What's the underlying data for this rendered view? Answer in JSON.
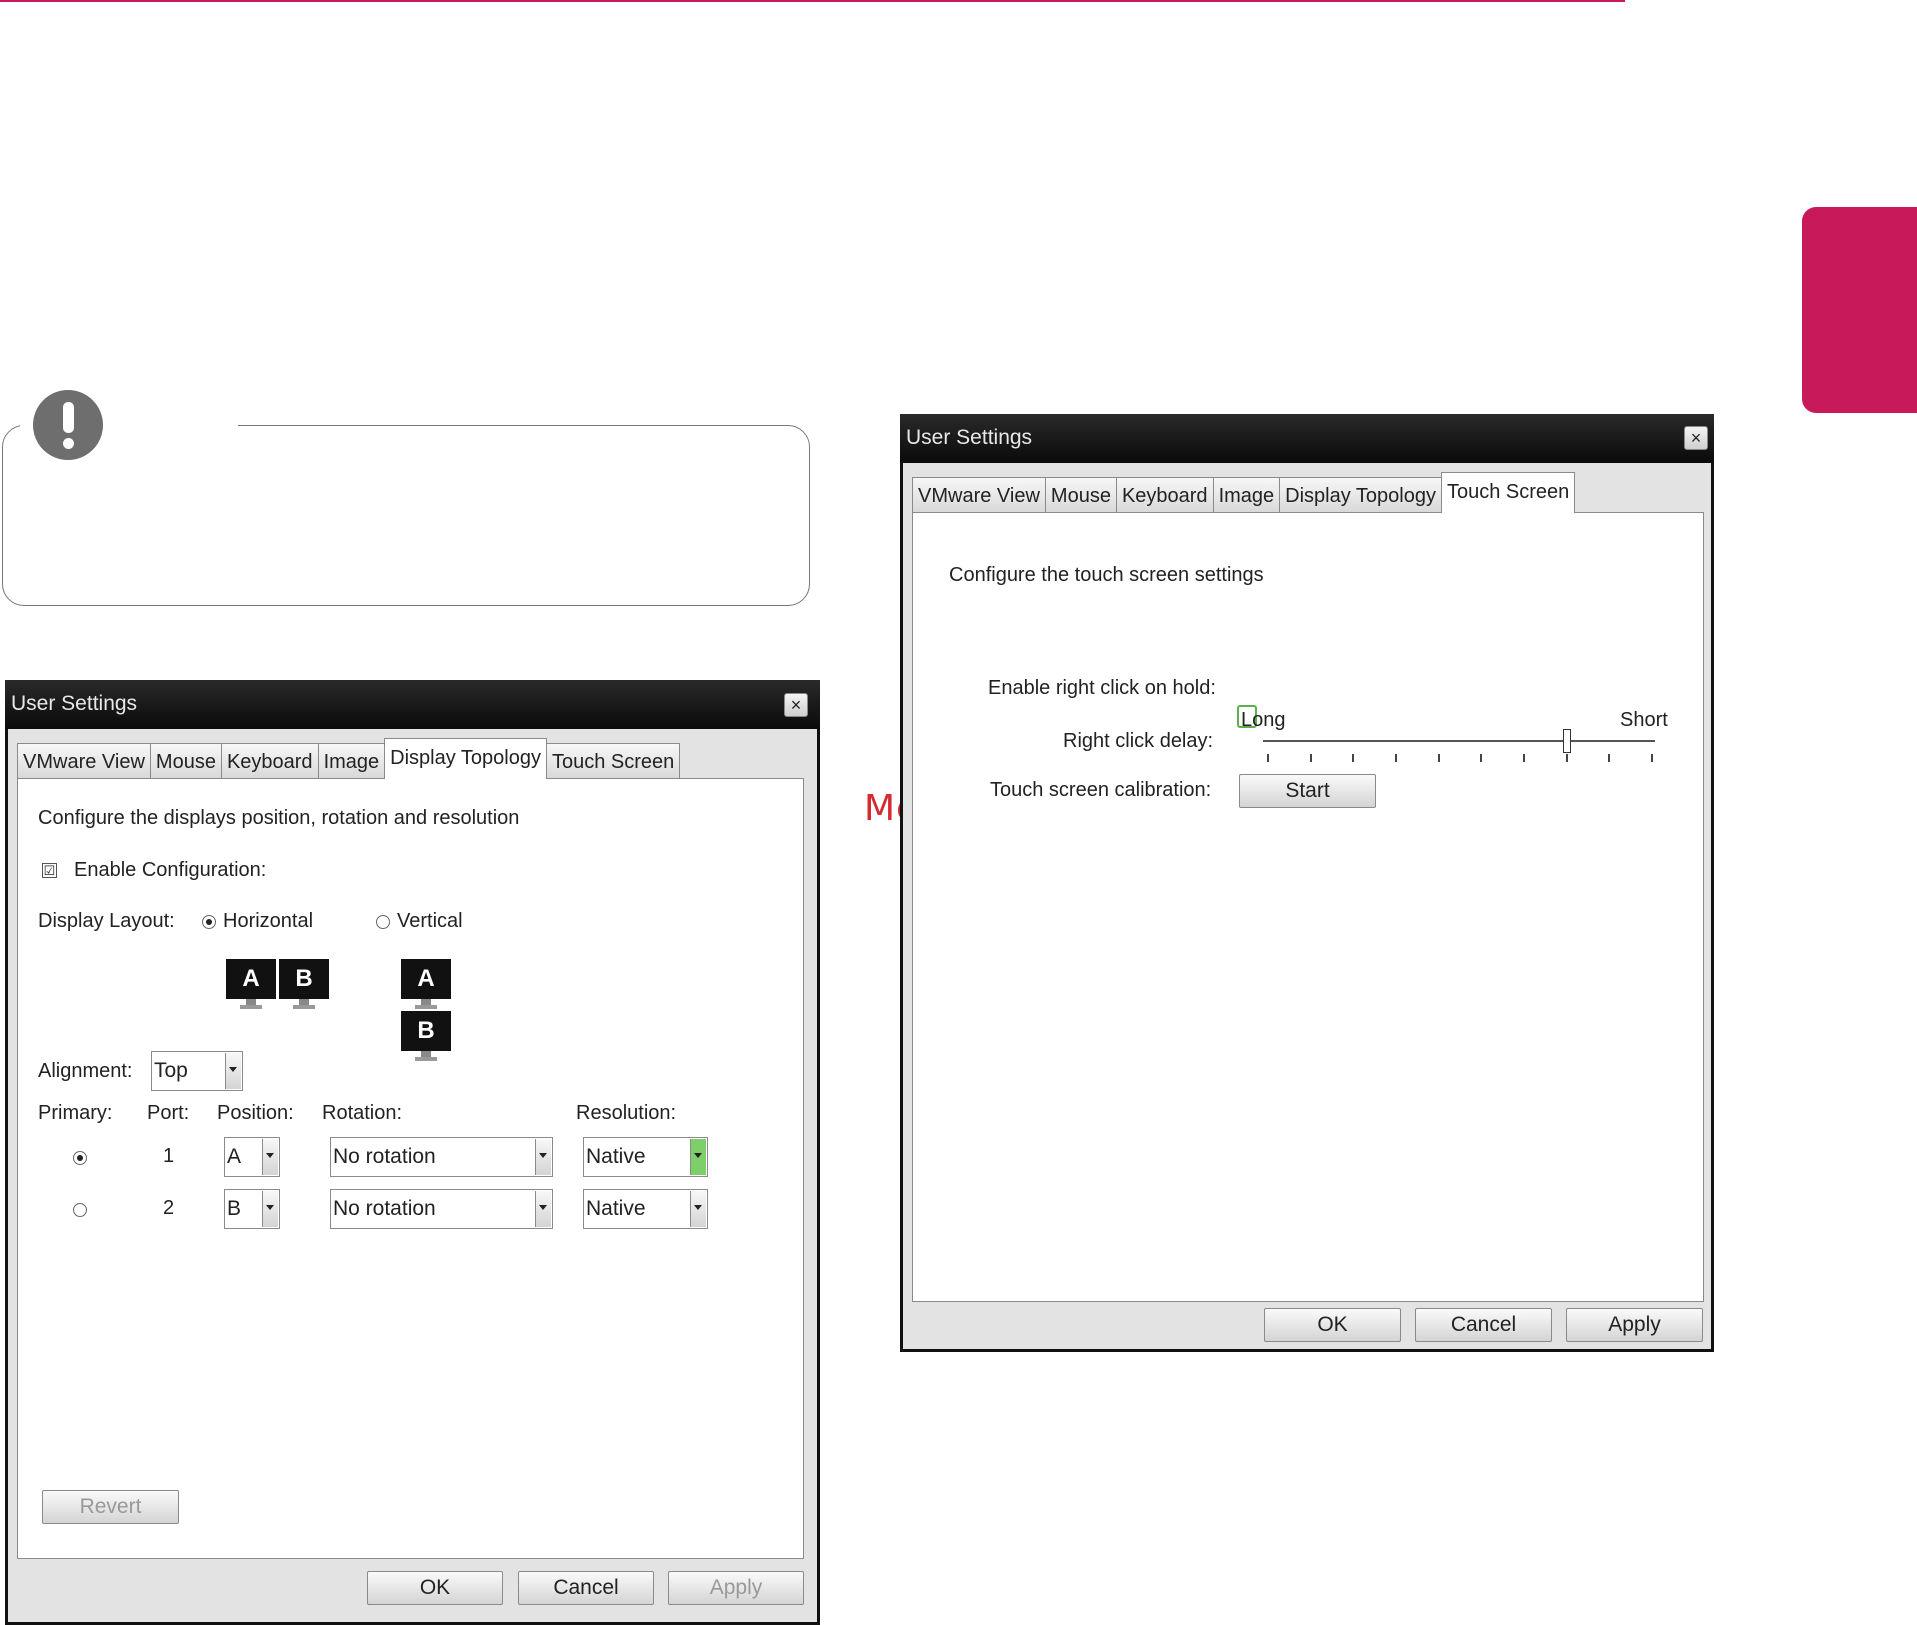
{
  "watermark": "McGrp.Ru",
  "left_dialog": {
    "title": "User Settings",
    "close": "×",
    "tabs": [
      "VMware View",
      "Mouse",
      "Keyboard",
      "Image",
      "Display Topology",
      "Touch Screen"
    ],
    "active_tab": "Display Topology",
    "description": "Configure the displays position, rotation and resolution",
    "enable_configuration": {
      "label": "Enable Configuration:",
      "checked": true,
      "mark": "☑"
    },
    "display_layout": {
      "label": "Display Layout:",
      "options": [
        {
          "label": "Horizontal",
          "selected": true
        },
        {
          "label": "Vertical",
          "selected": false
        }
      ],
      "monitor_labels": [
        "A",
        "B"
      ]
    },
    "alignment": {
      "label": "Alignment:",
      "value": "Top"
    },
    "columns": [
      "Primary:",
      "Port:",
      "Position:",
      "Rotation:",
      "Resolution:"
    ],
    "rows": [
      {
        "primary": true,
        "port": "1",
        "position": "A",
        "rotation": "No rotation",
        "resolution": "Native"
      },
      {
        "primary": false,
        "port": "2",
        "position": "B",
        "rotation": "No rotation",
        "resolution": "Native"
      }
    ],
    "revert_label": "Revert",
    "ok_label": "OK",
    "cancel_label": "Cancel",
    "apply_label": "Apply"
  },
  "right_dialog": {
    "title": "User Settings",
    "close": "×",
    "tabs": [
      "VMware View",
      "Mouse",
      "Keyboard",
      "Image",
      "Display Topology",
      "Touch Screen"
    ],
    "active_tab": "Touch Screen",
    "description": "Configure the touch screen settings",
    "enable_right_click": {
      "label": "Enable right click on hold:",
      "checked": false
    },
    "right_click_delay": {
      "label": "Right click delay:",
      "min_label": "Long",
      "max_label": "Short",
      "ticks": 10,
      "position": 0.78
    },
    "calibration": {
      "label": "Touch screen calibration:",
      "button": "Start"
    },
    "ok_label": "OK",
    "cancel_label": "Cancel",
    "apply_label": "Apply"
  },
  "colors": {
    "accent": "#c8195a",
    "watermark": "#d42a30",
    "titlebar": "#111111"
  }
}
